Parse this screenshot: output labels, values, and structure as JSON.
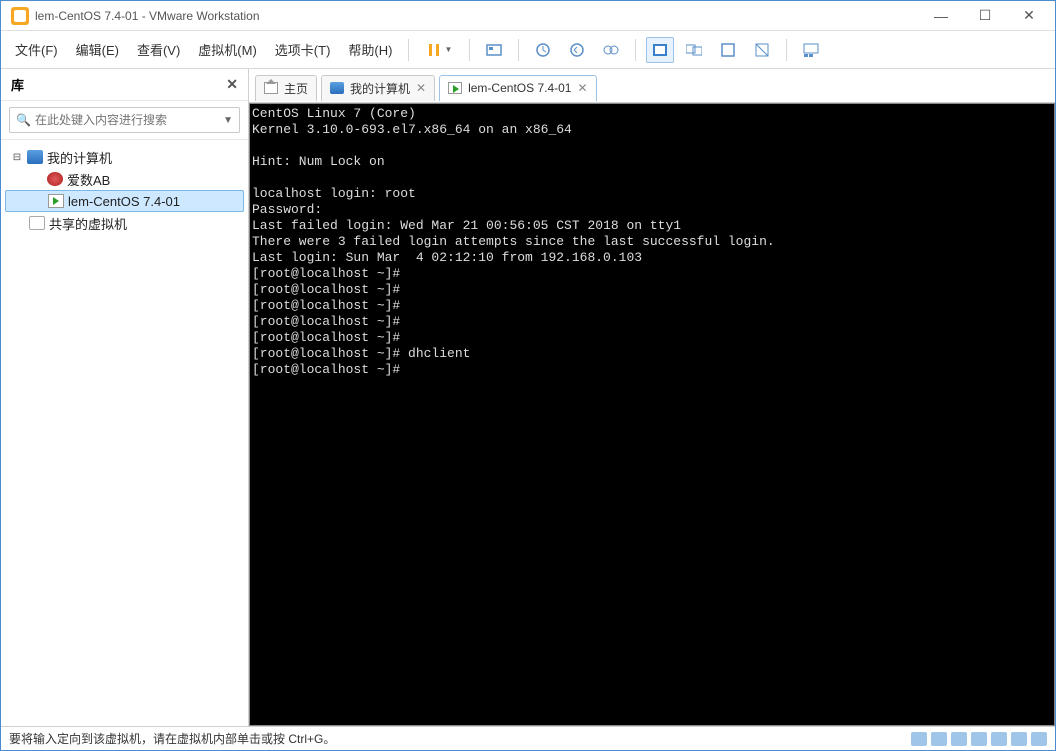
{
  "window": {
    "title": "lem-CentOS 7.4-01 - VMware Workstation"
  },
  "menus": {
    "file": "文件(F)",
    "edit": "编辑(E)",
    "view": "查看(V)",
    "vm": "虚拟机(M)",
    "tabs": "选项卡(T)",
    "help": "帮助(H)"
  },
  "sidebar": {
    "header": "库",
    "search_placeholder": "在此处键入内容进行搜索",
    "tree": {
      "mycomputer": "我的计算机",
      "vm1": "爱数AB",
      "vm2": "lem-CentOS 7.4-01",
      "shared": "共享的虚拟机"
    }
  },
  "tabs": {
    "home": "主页",
    "mycomputer": "我的计算机",
    "current": "lem-CentOS 7.4-01"
  },
  "console": {
    "line01": "CentOS Linux 7 (Core)",
    "line02": "Kernel 3.10.0-693.el7.x86_64 on an x86_64",
    "line03": "",
    "line04": "Hint: Num Lock on",
    "line05": "",
    "line06": "localhost login: root",
    "line07": "Password:",
    "line08": "Last failed login: Wed Mar 21 00:56:05 CST 2018 on tty1",
    "line09": "There were 3 failed login attempts since the last successful login.",
    "line10": "Last login: Sun Mar  4 02:12:10 from 192.168.0.103",
    "line11": "[root@localhost ~]#",
    "line12": "[root@localhost ~]#",
    "line13": "[root@localhost ~]#",
    "line14": "[root@localhost ~]#",
    "line15": "[root@localhost ~]#",
    "line16": "[root@localhost ~]# dhclient",
    "line17": "[root@localhost ~]#"
  },
  "statusbar": {
    "hint": "要将输入定向到该虚拟机，请在虚拟机内部单击或按 Ctrl+G。"
  }
}
